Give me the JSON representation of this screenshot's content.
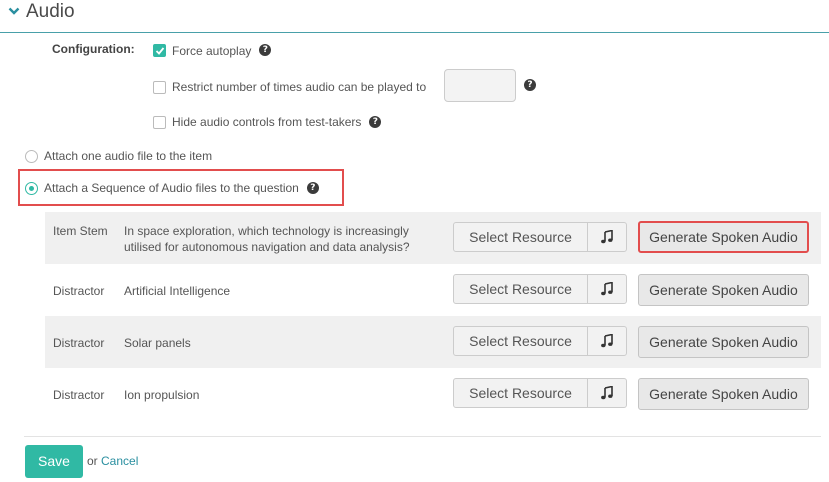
{
  "header": {
    "title": "Audio"
  },
  "configuration": {
    "label": "Configuration:",
    "force_autoplay": {
      "label": "Force autoplay",
      "checked": true
    },
    "restrict_plays": {
      "label": "Restrict number of times audio can be played to",
      "checked": false,
      "value": ""
    },
    "hide_controls": {
      "label": "Hide audio controls from test-takers",
      "checked": false
    }
  },
  "attach_options": {
    "single": {
      "label": "Attach one audio file to the item",
      "selected": false
    },
    "sequence": {
      "label": "Attach a Sequence of Audio files to the question",
      "selected": true
    }
  },
  "rows": [
    {
      "role": "Item Stem",
      "text": "In space exploration, which technology is increasingly utilised for autonomous navigation and data analysis?"
    },
    {
      "role": "Distractor",
      "text": "Artificial Intelligence"
    },
    {
      "role": "Distractor",
      "text": "Solar panels"
    },
    {
      "role": "Distractor",
      "text": "Ion propulsion"
    }
  ],
  "buttons": {
    "select_resource": "Select Resource",
    "generate_audio": "Generate Spoken Audio",
    "save": "Save",
    "or": "or",
    "cancel": "Cancel"
  },
  "icons": {
    "help": "help-icon",
    "music": "music-note-icon",
    "chevron": "chevron-down-icon"
  },
  "colors": {
    "accent": "#30b9a4",
    "highlight": "#e24d4d",
    "header_rule": "#49a0a9",
    "link": "#2a8fa0"
  }
}
